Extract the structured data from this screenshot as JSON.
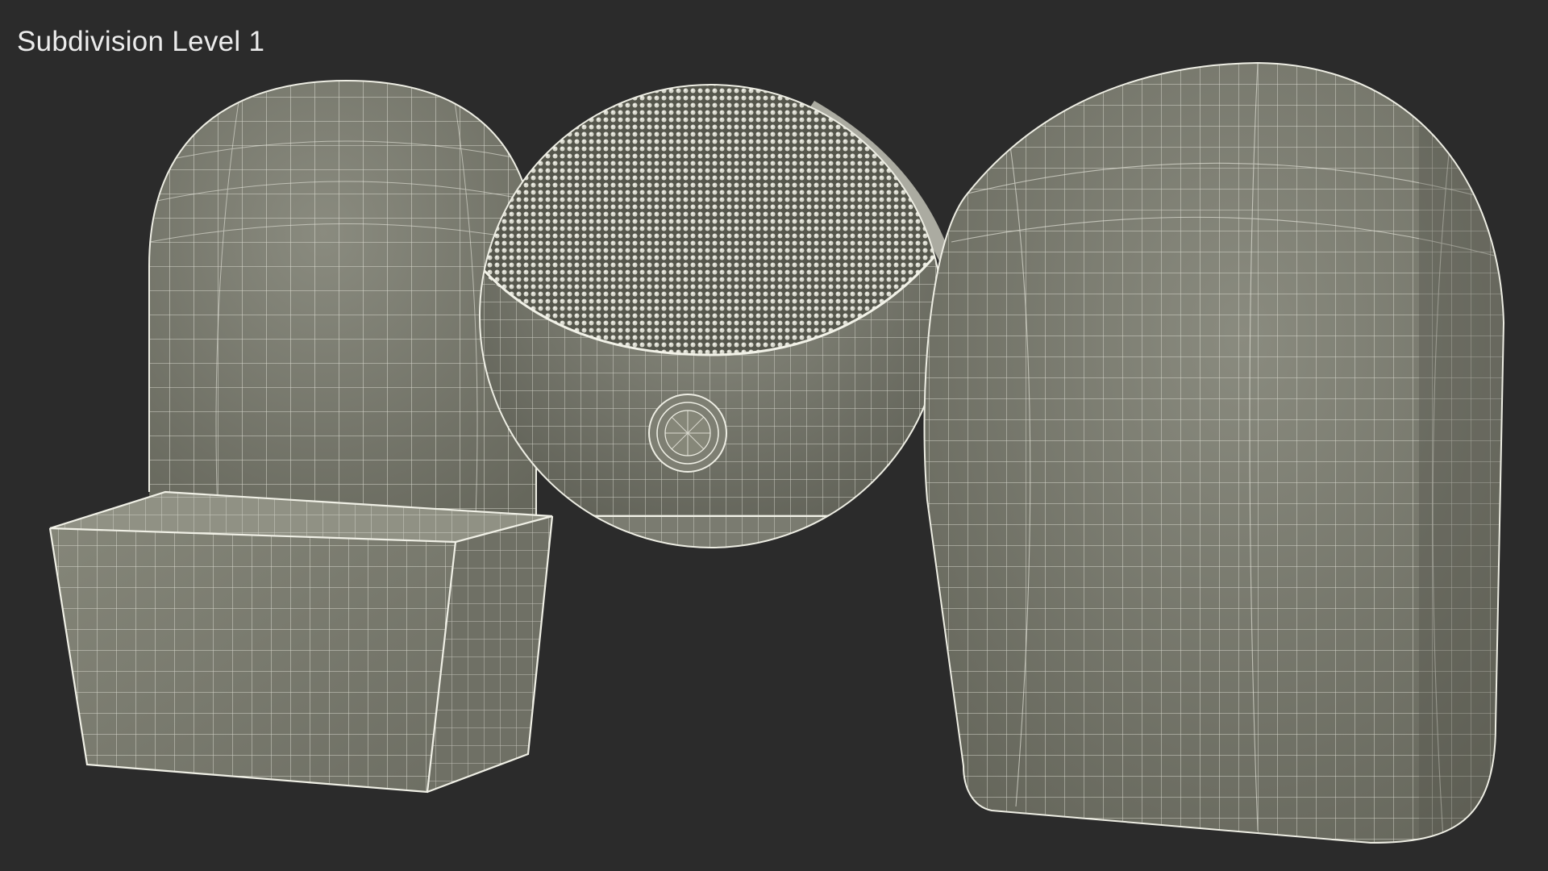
{
  "viewport": {
    "label": "Subdivision Level 1"
  },
  "scene": {
    "background_color": "#2b2b2b",
    "model_color": "#7c7d71",
    "wire_color": "#e9e9df",
    "objects": [
      "wireframe-stand",
      "wireframe-brush-head",
      "wireframe-cap"
    ]
  }
}
